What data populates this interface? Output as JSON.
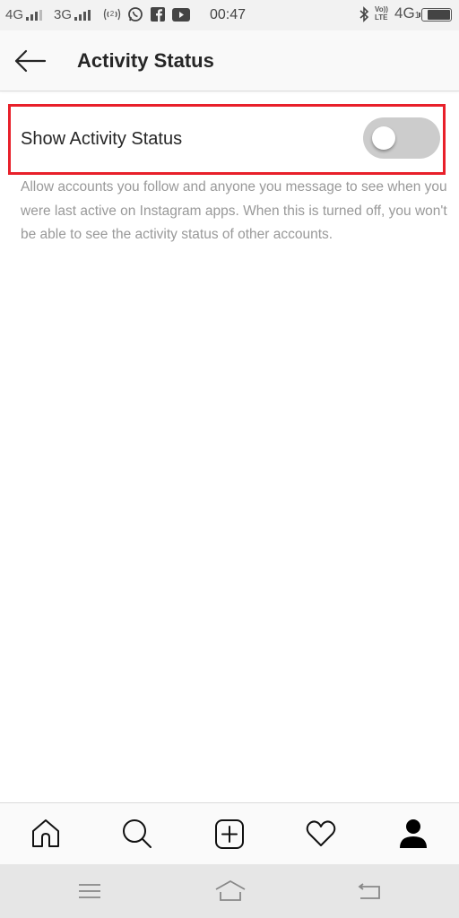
{
  "status_bar": {
    "network1": "4G",
    "network2": "3G",
    "hotspot_icon": "hotspot-icon",
    "whatsapp_icon": "whatsapp-icon",
    "facebook_icon": "facebook-icon",
    "youtube_icon": "youtube-icon",
    "time": "00:47",
    "bluetooth_icon": "bluetooth-icon",
    "volte_top": "Vo))",
    "volte_bottom": "LTE",
    "network3": "4G",
    "network3_sub": "1",
    "battery_level": 0.85
  },
  "header": {
    "back_icon": "arrow-left-icon",
    "title": "Activity Status"
  },
  "setting": {
    "label": "Show Activity Status",
    "toggle_on": false,
    "highlight_color": "#e8202a",
    "description": "Allow accounts you follow and anyone you message to see when you were last active on Instagram apps. When this is turned off, you won't be able to see the activity status of other accounts."
  },
  "tab_bar": {
    "items": [
      {
        "name": "home",
        "icon": "home-icon"
      },
      {
        "name": "search",
        "icon": "search-icon"
      },
      {
        "name": "new-post",
        "icon": "plus-square-icon"
      },
      {
        "name": "activity",
        "icon": "heart-icon"
      },
      {
        "name": "profile",
        "icon": "profile-icon"
      }
    ]
  },
  "system_nav": {
    "items": [
      {
        "name": "menu",
        "icon": "menu-icon"
      },
      {
        "name": "home",
        "icon": "home-outline-icon"
      },
      {
        "name": "back",
        "icon": "back-icon"
      }
    ]
  }
}
